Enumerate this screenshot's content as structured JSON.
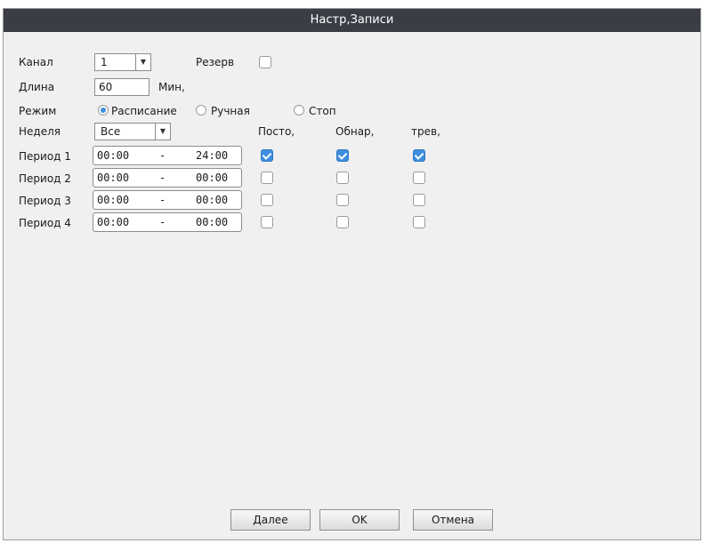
{
  "window": {
    "title": "Настр,Записи"
  },
  "channel": {
    "label": "Канал",
    "value": "1"
  },
  "reserve": {
    "label": "Резерв",
    "checked": false
  },
  "length": {
    "label": "Длина",
    "value": "60",
    "unit": "Мин,"
  },
  "mode": {
    "label": "Режим",
    "options": [
      {
        "label": "Расписание",
        "selected": true
      },
      {
        "label": "Ручная",
        "selected": false
      },
      {
        "label": "Стоп",
        "selected": false
      }
    ]
  },
  "week": {
    "label": "Неделя",
    "value": "Все"
  },
  "columns": [
    "Посто,",
    "Обнар,",
    "трев,"
  ],
  "periods": [
    {
      "label": "Период 1",
      "start": "00:00",
      "sep": "-",
      "end": "24:00",
      "checks": [
        true,
        true,
        true
      ]
    },
    {
      "label": "Период 2",
      "start": "00:00",
      "sep": "-",
      "end": "00:00",
      "checks": [
        false,
        false,
        false
      ]
    },
    {
      "label": "Период 3",
      "start": "00:00",
      "sep": "-",
      "end": "00:00",
      "checks": [
        false,
        false,
        false
      ]
    },
    {
      "label": "Период 4",
      "start": "00:00",
      "sep": "-",
      "end": "00:00",
      "checks": [
        false,
        false,
        false
      ]
    }
  ],
  "buttons": {
    "next": "Далее",
    "ok": "OK",
    "cancel": "Отмена"
  },
  "colors": {
    "titlebar": "#3b3d46",
    "accent": "#3d8ee0",
    "background": "#f0f0f0"
  }
}
